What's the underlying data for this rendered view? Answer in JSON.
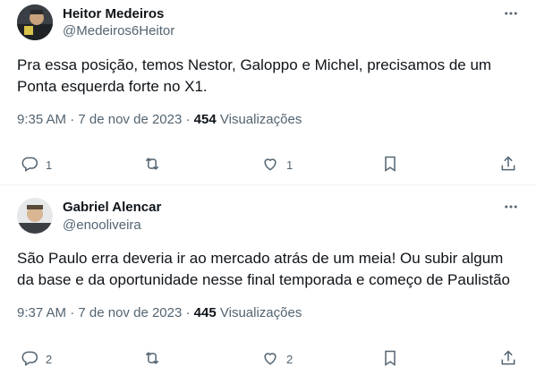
{
  "tweets": [
    {
      "author_name": "Heitor Medeiros",
      "author_handle": "@Medeiros6Heitor",
      "text": "Pra essa posição, temos Nestor, Galoppo e Michel, precisamos de um\nPonta esquerda forte no X1.",
      "time": "9:35 AM",
      "date": "7 de nov de 2023",
      "views_count": "454",
      "views_label": "Visualizações",
      "replies": "1",
      "retweets": "",
      "likes": "1"
    },
    {
      "author_name": "Gabriel Alencar",
      "author_handle": "@enooliveira",
      "text": "São Paulo erra deveria ir ao mercado atrás de um meia! Ou subir algum\nda base e da oportunidade nesse final temporada e começo de Paulistão",
      "time": "9:37 AM",
      "date": "7 de nov de 2023",
      "views_count": "445",
      "views_label": "Visualizações",
      "replies": "2",
      "retweets": "",
      "likes": "2"
    }
  ],
  "icons": {
    "more": "more-horizontal-icon",
    "reply": "reply-icon",
    "retweet": "retweet-icon",
    "like": "heart-icon",
    "bookmark": "bookmark-icon",
    "share": "share-icon"
  },
  "colors": {
    "text_primary": "#0f1419",
    "text_secondary": "#536471",
    "divider": "#eff3f4"
  }
}
